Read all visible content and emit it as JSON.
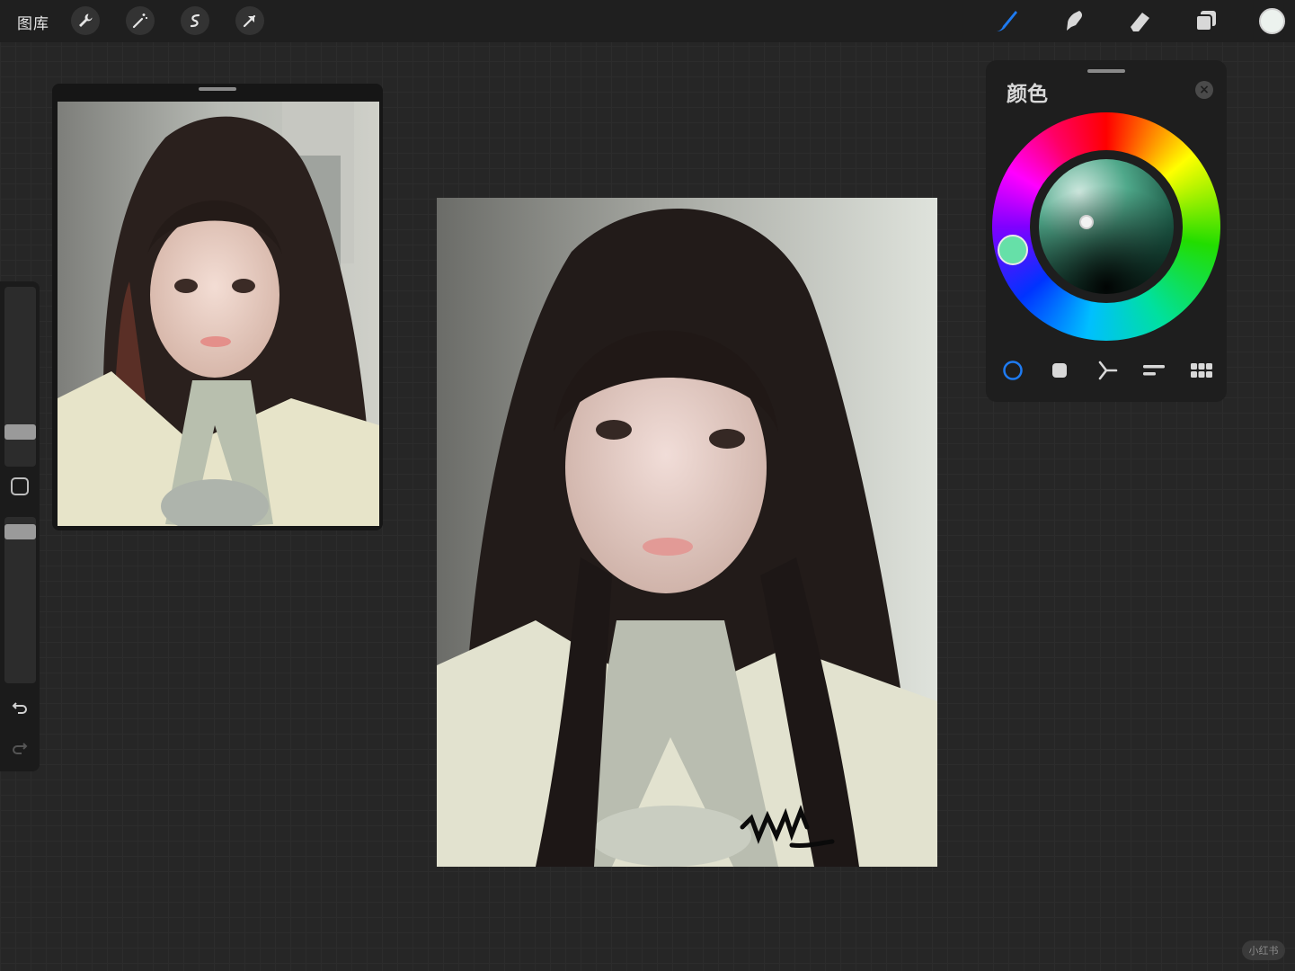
{
  "topbar": {
    "gallery_label": "图库",
    "left_tools": [
      "wrench-icon",
      "magic-wand-icon",
      "selection-icon",
      "transform-arrow-icon"
    ],
    "right_tools": [
      "brush-icon",
      "smudge-icon",
      "eraser-icon",
      "layers-icon"
    ],
    "active_color": "#ECF2EE",
    "accent": "#1E7BF2"
  },
  "color_panel": {
    "title": "颜色",
    "close_icon": "close-icon",
    "mode_icons": [
      "disc-icon",
      "classic-square-icon",
      "harmony-icon",
      "value-sliders-icon",
      "palettes-grid-icon"
    ],
    "selected_mode": "disc"
  },
  "canvas": {
    "signature_text": "wiwi"
  },
  "watermark": "小红书"
}
